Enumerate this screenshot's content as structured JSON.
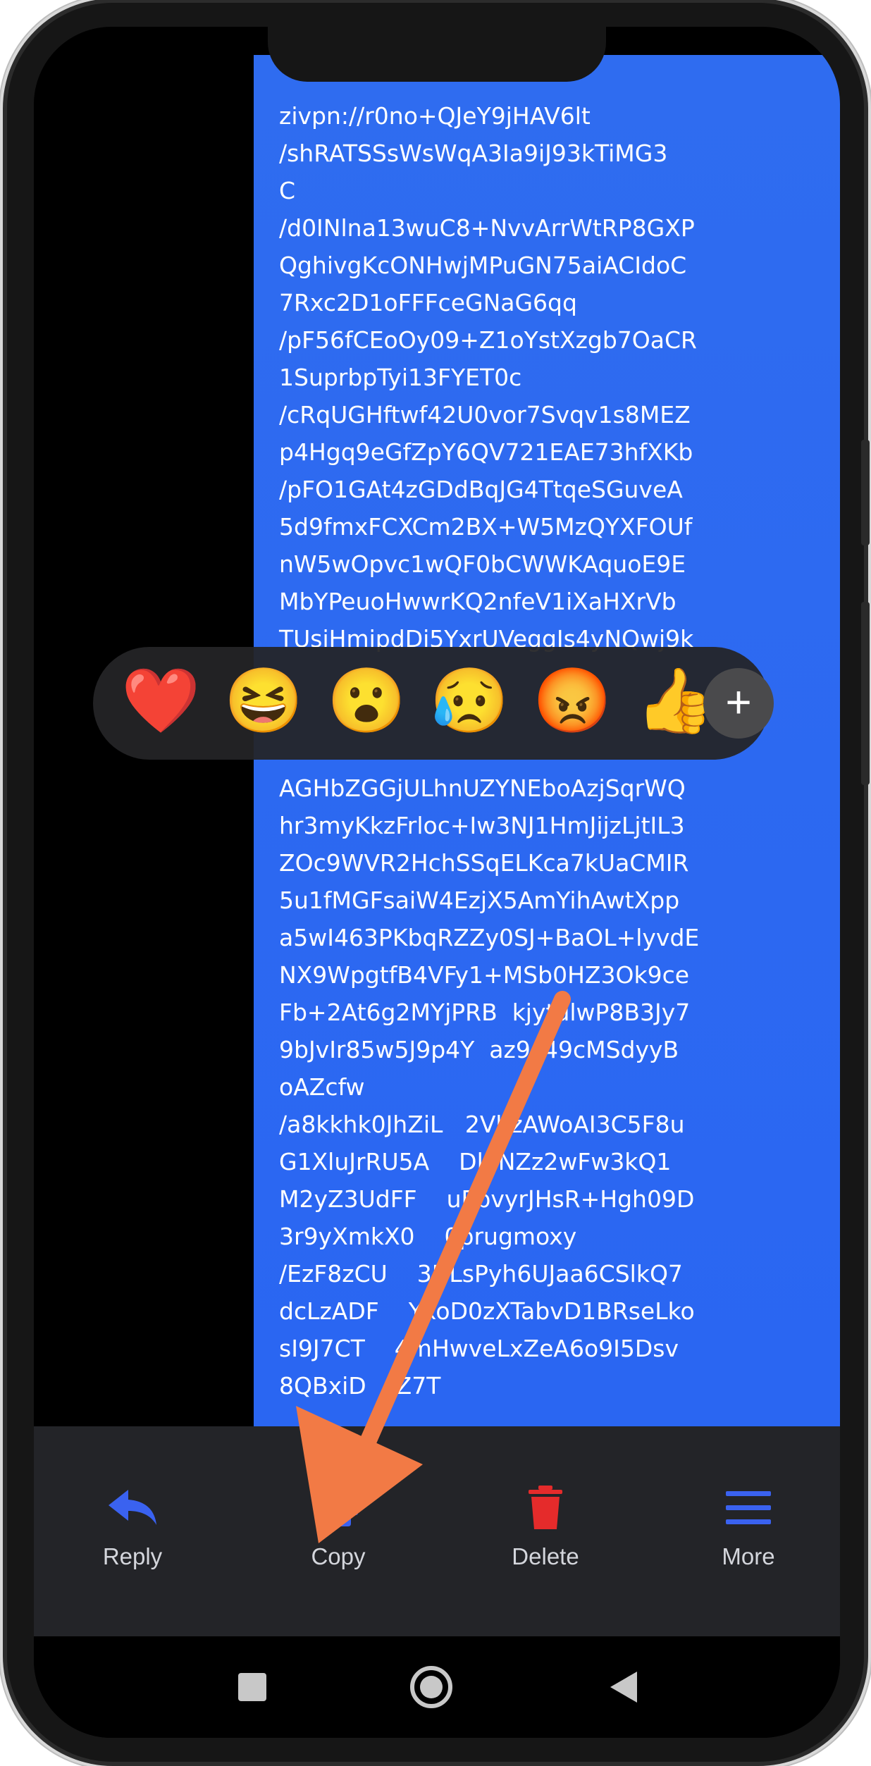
{
  "message": {
    "lines": [
      "zivpn://r0no+QJeY9jHAV6lt",
      "/shRATSSsWsWqA3Ia9iJ93kTiMG3",
      "C",
      "/d0INlna13wuC8+NvvArrWtRP8GXP",
      "QghivgKcONHwjMPuGN75aiACIdoC",
      "7Rxc2D1oFFFceGNaG6qq",
      "/pF56fCEoOy09+Z1oYstXzgb7OaCR",
      "1SuprbpTyi13FYET0c",
      "/cRqUGHftwf42U0vor7Svqv1s8MEZ",
      "p4Hgq9eGfZpY6QV721EAE73hfXKb",
      "/pFO1GAt4zGDdBqJG4TtqeSGuveA",
      "5d9fmxFCXCm2BX+W5MzQYXFOUf",
      "nW5wOpvc1wQF0bCWWKAquoE9E",
      "MbYPeuoHwwrKQ2nfeV1iXaHXrVb",
      "TUsiHmipdDi5YxrUVeggIs4yNQwj9k",
      "",
      "",
      "",
      "AGHbZGGjULhnUZYNEboAzjSqrWQ",
      "hr3myKkzFrloc+Iw3NJ1HmJijzLjtIL3",
      "ZOc9WVR2HchSSqELKca7kUaCMIR",
      "5u1fMGFsaiW4EzjX5AmYihAwtXpp",
      "a5wI463PKbqRZZy0SJ+BaOL+lyvdE",
      "NX9WpgtfB4VFy1+MSb0HZ3Ok9ce",
      "Fb+2At6g2MYjPRB  kjytulwP8B3Jy7",
      "9bJvIr85w5J9p4Y  az9c49cMSdyyB",
      "oAZcfw",
      "/a8kkhk0JhZiL   2VhzAWoAI3C5F8u",
      "G1XluJrRU5A    Dl1NZz2wFw3kQ1",
      "M2yZ3UdFF    uEbvyrJHsR+Hgh09D",
      "3r9yXmkX0    0prugmoxy",
      "/EzF8zCU    3NLsPyh6UJaa6CSlkQ7",
      "dcLzADF    YxoD0zXTabvD1BRseLko",
      "sI9J7CT    4mHwveLxZeA6o9I5Dsv",
      "8QBxiD    Z7T"
    ]
  },
  "reactions": {
    "emojis": [
      "❤️",
      "😆",
      "😮",
      "😥",
      "😡",
      "👍"
    ],
    "more_symbol": "+"
  },
  "actions": {
    "reply_label": "Reply",
    "copy_label": "Copy",
    "delete_label": "Delete",
    "more_label": "More"
  },
  "colors": {
    "bubble": "#2a66f2",
    "action_icon_blue": "#3a62f0",
    "delete_red": "#e52b2b",
    "arrow": "#f27a45"
  }
}
